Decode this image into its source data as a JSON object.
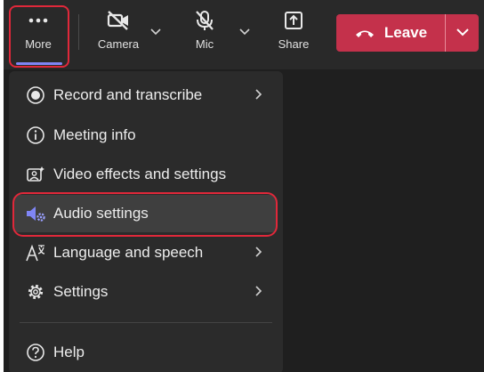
{
  "toolbar": {
    "more": {
      "label": "More",
      "icon": "more-dots-icon"
    },
    "camera": {
      "label": "Camera",
      "icon": "camera-off-icon"
    },
    "mic": {
      "label": "Mic",
      "icon": "mic-off-icon"
    },
    "share": {
      "label": "Share",
      "icon": "share-icon"
    },
    "leave": {
      "label": "Leave",
      "icon": "phone-hangup-icon"
    }
  },
  "menu": {
    "items": [
      {
        "label": "Record and transcribe",
        "icon": "record-icon",
        "submenu": true
      },
      {
        "label": "Meeting info",
        "icon": "info-icon",
        "submenu": false
      },
      {
        "label": "Video effects and settings",
        "icon": "video-effects-icon",
        "submenu": false
      },
      {
        "label": "Audio settings",
        "icon": "audio-settings-icon",
        "submenu": false,
        "highlighted": true
      },
      {
        "label": "Language and speech",
        "icon": "language-icon",
        "submenu": true
      },
      {
        "label": "Settings",
        "icon": "gear-icon",
        "submenu": true
      },
      {
        "label": "Help",
        "icon": "help-icon",
        "submenu": false
      }
    ]
  },
  "colors": {
    "leave": "#c4314b",
    "highlight": "#e0283a",
    "accent": "#7f85f5",
    "audio_icon": "#7f85f5"
  }
}
